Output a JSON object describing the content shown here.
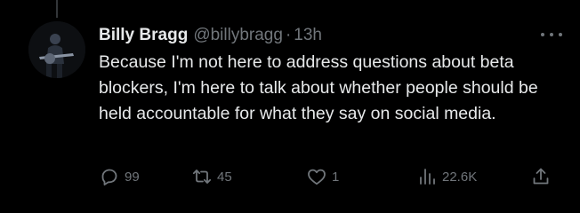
{
  "tweet": {
    "display_name": "Billy Bragg",
    "handle": "@billybragg",
    "separator": "·",
    "time": "13h",
    "text": "Because I'm not here to address questions about beta blockers, I'm here to talk about whether people should be held accountable for what they say on social media."
  },
  "actions": {
    "replies": "99",
    "retweets": "45",
    "likes": "1",
    "views": "22.6K"
  },
  "icons": {
    "avatar": "profile-photo",
    "more": "more-icon",
    "reply": "reply-icon",
    "retweet": "retweet-icon",
    "like": "heart-icon",
    "views": "views-icon",
    "share": "share-icon"
  },
  "colors": {
    "background": "#000000",
    "primary_text": "#e7e9ea",
    "secondary_text": "#71767b"
  }
}
